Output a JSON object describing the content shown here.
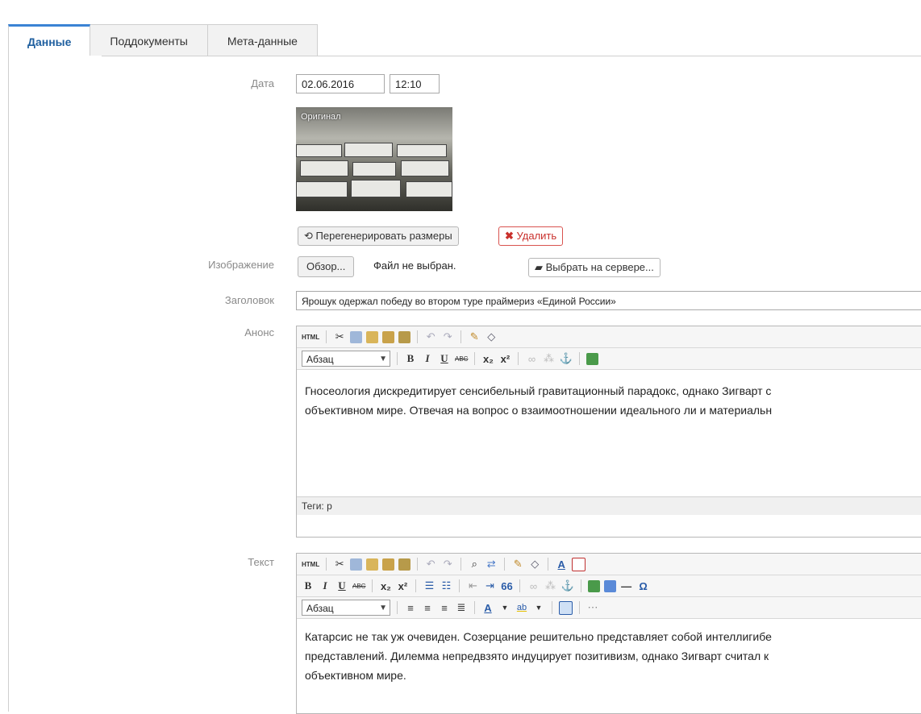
{
  "tabs": [
    {
      "label": "Данные",
      "active": true
    },
    {
      "label": "Поддокументы",
      "active": false
    },
    {
      "label": "Мета-данные",
      "active": false
    }
  ],
  "form": {
    "date_label": "Дата",
    "date_value": "02.06.2016",
    "time_value": "12:10",
    "photo_caption": "Оригинал",
    "regen_button": "Перегенерировать размеры",
    "delete_button": "Удалить",
    "image_label": "Изображение",
    "browse_button": "Обзор...",
    "file_status": "Файл не выбран.",
    "choose_server_button": "Выбрать на сервере...",
    "title_label": "Заголовок",
    "title_value": "Ярошук одержал победу во втором туре праймериз «Единой России»",
    "anons_label": "Анонс",
    "text_label": "Текст"
  },
  "anons_editor": {
    "format": "Абзац",
    "content_line1": "Гносеология дискредитирует сенсибельный гравитационный парадокс, однако Зигварт с",
    "content_line2": "объективном мире. Отвечая на вопрос о взаимоотношении идеального ли и материальн",
    "status": "Теги: p"
  },
  "text_editor": {
    "format": "Абзац",
    "content_line1": "Катарсис не так уж очевиден. Созерцание решительно представляет собой интеллигибе",
    "content_line2": "представлений. Дилемма непредвзято индуцирует позитивизм, однако Зигварт считал к",
    "content_line3": "объективном мире."
  },
  "toolbar": {
    "html": "HTML",
    "bold": "B",
    "italic": "I",
    "underline": "U",
    "strike": "ABC",
    "sub": "x₂",
    "sup": "x²",
    "anchor": "⚓",
    "quote": "66",
    "hr": "—",
    "omega": "Ω",
    "font_color": "A",
    "highlight": "ab"
  },
  "colors": {
    "accent": "#3b83d4",
    "delete_red": "#d9534f",
    "label_grey": "#8a8a8a"
  }
}
